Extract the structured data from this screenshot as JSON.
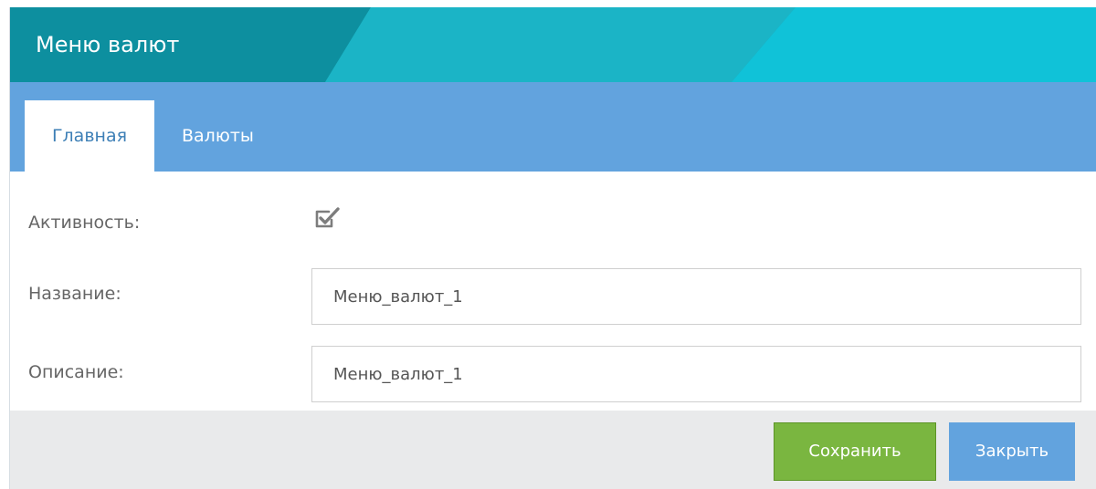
{
  "window": {
    "title": "Меню валют"
  },
  "tabs": [
    {
      "label": "Главная",
      "active": true
    },
    {
      "label": "Валюты",
      "active": false
    }
  ],
  "form": {
    "active": {
      "label": "Активность:",
      "checked": true
    },
    "name": {
      "label": "Название:",
      "value": "Меню_валют_1"
    },
    "description": {
      "label": "Описание:",
      "value": "Меню_валют_1"
    }
  },
  "footer": {
    "save_label": "Сохранить",
    "close_label": "Закрыть"
  },
  "colors": {
    "header": "#15a7b8",
    "tabbar": "#62a3de",
    "save": "#7ab640",
    "close": "#62a3de"
  },
  "icons": {
    "checkbox": "checkbox-checked-icon"
  }
}
